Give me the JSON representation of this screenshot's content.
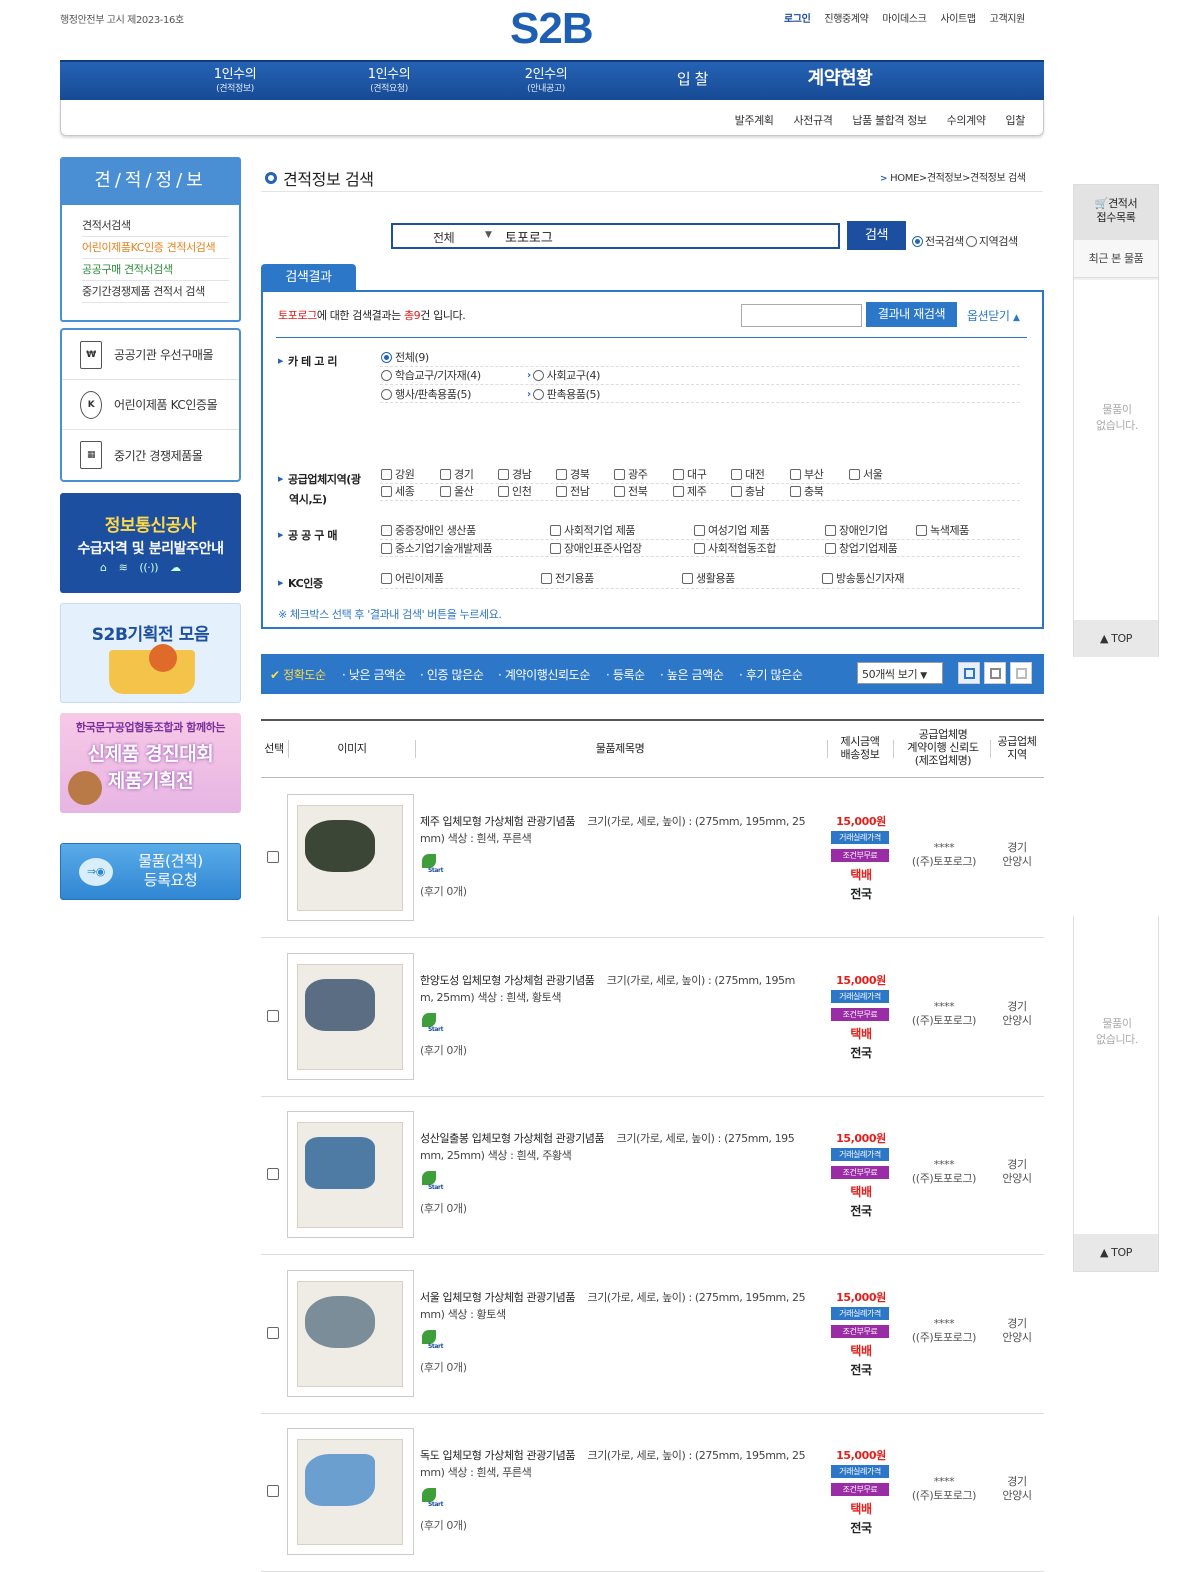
{
  "header": {
    "notice": "행정안전부 고시 제2023-16호",
    "logo": "S2B",
    "links": [
      "로그인",
      "진행중계약",
      "마이데스크",
      "사이트맵",
      "고객지원"
    ]
  },
  "gnb": [
    {
      "label": "1인수의",
      "sub": "(견적정보)"
    },
    {
      "label": "1인수의",
      "sub": "(견적요청)"
    },
    {
      "label": "2인수의",
      "sub": "(안내공고)"
    },
    {
      "label": "입 찰",
      "sub": ""
    },
    {
      "label": "계약현황",
      "sub": ""
    }
  ],
  "subnav": [
    "발주계획",
    "사전규격",
    "납품 불합격 정보",
    "수의계약",
    "입찰"
  ],
  "sidebar": {
    "title": "견/적/정/보",
    "links": [
      "견적서검색",
      "어린이제품KC인증 견적서검색",
      "공공구매 견적서검색",
      "중기간경쟁제품 견적서 검색"
    ],
    "shops": [
      {
        "icon": "won-doc-icon",
        "label": "공공기관 우선구매몰"
      },
      {
        "icon": "kc-mark-icon",
        "label": "어린이제품 KC인증몰"
      },
      {
        "icon": "building-icon",
        "label": "중기간 경쟁제품몰"
      }
    ],
    "banner1": {
      "line1": "정보통신공사",
      "line2": "수급자격 및 분리발주안내"
    },
    "banner2": {
      "line1": "S2B기획전 모음"
    },
    "banner3": {
      "line1": "한국문구공업협동조합과 함께하는",
      "line2": "신제품 경진대회",
      "line3": "제품기획전"
    },
    "banner4": {
      "line1": "물품(견적)",
      "line2": "등록요청"
    }
  },
  "page": {
    "title": "견적정보 검색",
    "breadcrumb": "HOME>견적정보>견적정보 검색"
  },
  "search": {
    "category": "전체",
    "query": "토포로그",
    "button": "검색",
    "scope_options": [
      "전국검색",
      "지역검색"
    ],
    "scope_selected": "전국검색"
  },
  "results": {
    "tab": "검색결과",
    "keyword": "토포로그",
    "summary_mid": "에 대한 검색결과는 ",
    "count_text": "총9",
    "summary_end": "건 입니다.",
    "refine_button": "결과내 재검색",
    "options_close": "옵션닫기",
    "note": "※ 체크박스 선택 후 '결과내 검색' 버튼을 누르세요."
  },
  "filters": {
    "category_label": "카 테 고 리",
    "categories": [
      "전체(9)",
      "학습교구/기자재(4)",
      "사회교구(4)",
      "행사/판촉용품(5)",
      "판촉용품(5)"
    ],
    "region_label_1": "공급업체지역(광",
    "region_label_2": "역시,도)",
    "regions": [
      "강원",
      "경기",
      "경남",
      "경북",
      "광주",
      "대구",
      "대전",
      "부산",
      "서울",
      "세종",
      "울산",
      "인천",
      "전남",
      "전북",
      "제주",
      "충남",
      "충북"
    ],
    "public_label": "공 공 구 매",
    "public": [
      "중증장애인 생산품",
      "사회적기업 제품",
      "여성기업 제품",
      "장애인기업",
      "녹색제품",
      "중소기업기술개발제품",
      "장애인표준사업장",
      "사회적협동조합",
      "창업기업제품"
    ],
    "kc_label": "KC인증",
    "kc": [
      "어린이제품",
      "전기용품",
      "생활용품",
      "방송통신기자재"
    ]
  },
  "sort": {
    "options": [
      "정확도순",
      "낮은 금액순",
      "인증 많은순",
      "계약이행신뢰도순",
      "등록순",
      "높은 금액순",
      "후기 많은순"
    ],
    "active": "정확도순",
    "per_page": "50개씩 보기"
  },
  "table": {
    "headers": {
      "select": "선택",
      "image": "이미지",
      "name": "물품제목명",
      "price_1": "제시금액",
      "price_2": "배송정보",
      "supplier_1": "공급업체명",
      "supplier_2": "계약이행 신뢰도",
      "supplier_3": "(제조업체명)",
      "region_1": "공급업체",
      "region_2": "지역"
    }
  },
  "products": [
    {
      "title": "제주 입체모형 가상체험 관광기념품",
      "spec1": "크기(가로, 세로, 높이) : (275mm, 195mm, 25",
      "spec2": "mm) 색상 : 흰색, 푸른색",
      "reviews": "(후기 0개)",
      "price": "15,000원",
      "tag1": "거래실례가격",
      "tag2": "조건부무료",
      "delivery": "택배",
      "area": "전국",
      "rating": "****",
      "supplier": "((주)토포로그)",
      "region1": "경기",
      "region2": "안양시"
    },
    {
      "title": "한양도성 입체모형 가상체험 관광기념품",
      "spec1": "크기(가로, 세로, 높이) : (275mm, 195m",
      "spec2": "m, 25mm) 색상 : 흰색, 황토색",
      "reviews": "(후기 0개)",
      "price": "15,000원",
      "tag1": "거래실례가격",
      "tag2": "조건부무료",
      "delivery": "택배",
      "area": "전국",
      "rating": "****",
      "supplier": "((주)토포로그)",
      "region1": "경기",
      "region2": "안양시"
    },
    {
      "title": "성산일출봉 입체모형 가상체험 관광기념품",
      "spec1": "크기(가로, 세로, 높이) : (275mm, 195",
      "spec2": "mm, 25mm) 색상 : 흰색, 주황색",
      "reviews": "(후기 0개)",
      "price": "15,000원",
      "tag1": "거래실례가격",
      "tag2": "조건부무료",
      "delivery": "택배",
      "area": "전국",
      "rating": "****",
      "supplier": "((주)토포로그)",
      "region1": "경기",
      "region2": "안양시"
    },
    {
      "title": "서울 입체모형 가상체험 관광기념품",
      "spec1": "크기(가로, 세로, 높이) : (275mm, 195mm, 25",
      "spec2": "mm) 색상 : 황토색",
      "reviews": "(후기 0개)",
      "price": "15,000원",
      "tag1": "거래실례가격",
      "tag2": "조건부무료",
      "delivery": "택배",
      "area": "전국",
      "rating": "****",
      "supplier": "((주)토포로그)",
      "region1": "경기",
      "region2": "안양시"
    },
    {
      "title": "독도 입체모형 가상체험 관광기념품",
      "spec1": "크기(가로, 세로, 높이) : (275mm, 195mm, 25",
      "spec2": "mm) 색상 : 흰색, 푸른색",
      "reviews": "(후기 0개)",
      "price": "15,000원",
      "tag1": "거래실례가격",
      "tag2": "조건부무료",
      "delivery": "택배",
      "area": "전국",
      "rating": "****",
      "supplier": "((주)토포로그)",
      "region1": "경기",
      "region2": "안양시"
    }
  ],
  "right_panel": {
    "cart_1": "견적서",
    "cart_2": "접수목록",
    "recent": "최근 본 물품",
    "empty_1": "물품이",
    "empty_2": "없습니다.",
    "top": "TOP"
  },
  "colors": {
    "brand": "#1e5fb3",
    "accent": "#2d77c8",
    "price": "#e0201c",
    "tag_purple": "#9a2ca6"
  }
}
